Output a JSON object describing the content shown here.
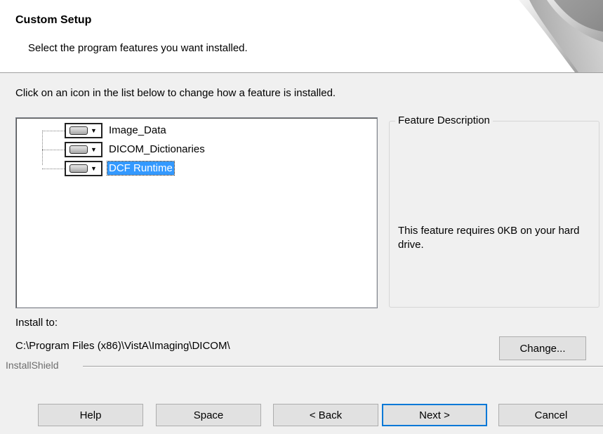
{
  "header": {
    "title": "Custom Setup",
    "subtitle": "Select the program features you want installed."
  },
  "instruction": "Click on an icon in the list below to change how a feature is installed.",
  "features": [
    {
      "label": "Image_Data",
      "selected": false,
      "icon": "hard-drive-icon"
    },
    {
      "label": "DICOM_Dictionaries",
      "selected": false,
      "icon": "hard-drive-icon"
    },
    {
      "label": "DCF Runtime",
      "selected": true,
      "icon": "hard-drive-icon"
    }
  ],
  "description": {
    "legend": "Feature Description",
    "text": "This feature requires 0KB on your hard drive."
  },
  "install": {
    "label": "Install to:",
    "path": "C:\\Program Files (x86)\\VistA\\Imaging\\DICOM\\",
    "change_label": "Change..."
  },
  "footer": {
    "brand": "InstallShield",
    "buttons": {
      "help": "Help",
      "space": "Space",
      "back": "< Back",
      "next": "Next >",
      "cancel": "Cancel"
    }
  },
  "colors": {
    "selection": "#3399ff",
    "default_button_border": "#0078d7"
  }
}
